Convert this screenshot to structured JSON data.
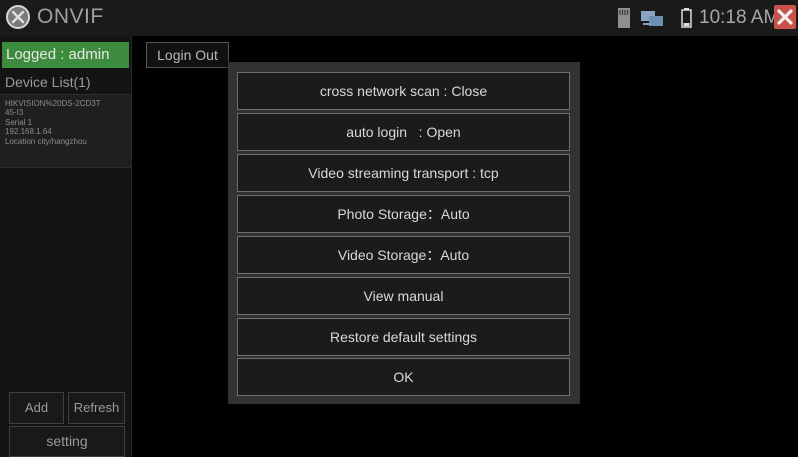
{
  "topbar": {
    "app_title": "ONVIF",
    "clock": "10:18 AM",
    "icons": [
      "onvif-logo-icon",
      "sd-card-icon",
      "network-icon",
      "battery-icon",
      "close-icon"
    ],
    "close_color": "#c9524a"
  },
  "sidebar": {
    "logged_label": "Logged : admin",
    "device_list_title": "Device List(1)",
    "device": {
      "name_line1": "HIKVISION%20DS-2CD3T",
      "name_line2": "45-I3",
      "serial": "Serial  1",
      "ip": "192.168.1.64",
      "location": "Location  city/hangzhou"
    },
    "add_label": "Add",
    "refresh_label": "Refresh",
    "setting_label": "setting",
    "logged_color": "#3d8c3d"
  },
  "main": {
    "login_out_label": "Login Out"
  },
  "dialog": {
    "options": [
      "cross network scan : Close",
      "auto login   : Open",
      "Video streaming transport : tcp",
      "Photo Storage：Auto",
      "Video Storage：Auto",
      "View manual",
      "Restore default settings",
      "OK"
    ]
  }
}
